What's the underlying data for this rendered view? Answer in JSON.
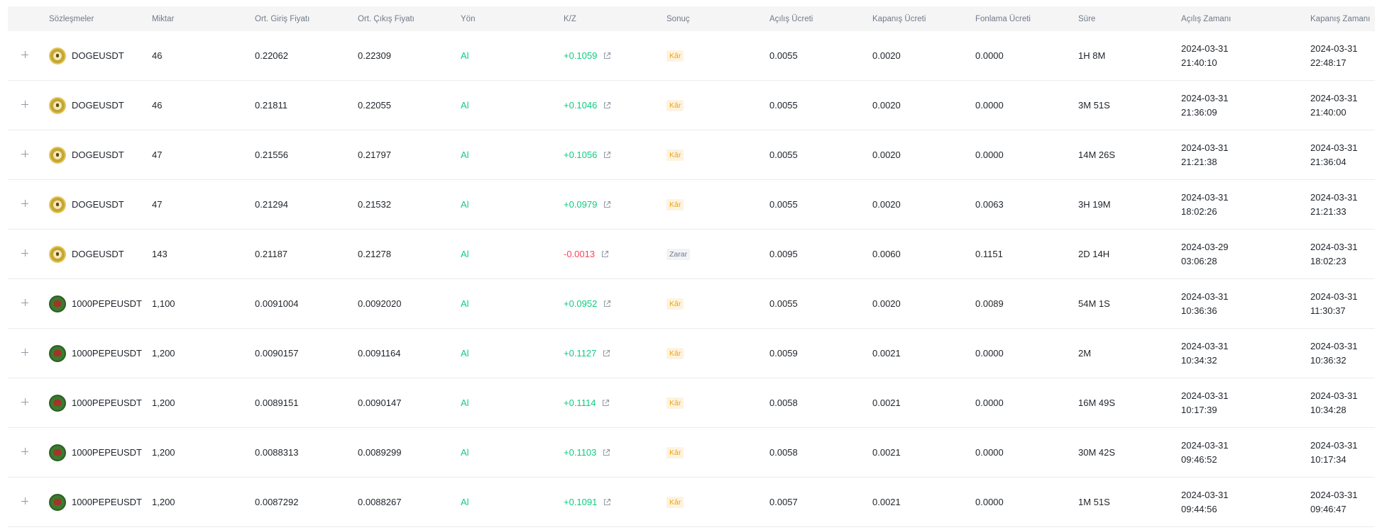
{
  "columns": {
    "symbol": "Sözleşmeler",
    "quantity": "Miktar",
    "entry": "Ort. Giriş Fiyatı",
    "exit": "Ort. Çıkış Fiyatı",
    "side": "Yön",
    "pnl": "K/Z",
    "result": "Sonuç",
    "open_fee": "Açılış Ücreti",
    "close_fee": "Kapanış Ücreti",
    "funding_fee": "Fonlama Ücreti",
    "duration": "Süre",
    "open_time": "Açılış Zamanı",
    "close_time": "Kapanış Zamanı"
  },
  "colors": {
    "profit": "#0ecb81",
    "loss": "#f6465d",
    "win_badge": "#f0a50a"
  },
  "icons": {
    "expand": "plus-icon",
    "share": "external-link-icon",
    "doge": "doge-coin-icon",
    "pepe": "pepe-coin-icon"
  },
  "rows": [
    {
      "symbol": "DOGEUSDT",
      "coin": "doge",
      "quantity": "46",
      "entry": "0.22062",
      "exit": "0.22309",
      "side": "Al",
      "pnl": "+0.1059",
      "pnl_sign": "pos",
      "result": "Kâr",
      "result_type": "win",
      "open_fee": "0.0055",
      "close_fee": "0.0020",
      "funding_fee": "0.0000",
      "duration": "1H 8M",
      "open_date": "2024-03-31",
      "open_clock": "21:40:10",
      "close_date": "2024-03-31",
      "close_clock": "22:48:17"
    },
    {
      "symbol": "DOGEUSDT",
      "coin": "doge",
      "quantity": "46",
      "entry": "0.21811",
      "exit": "0.22055",
      "side": "Al",
      "pnl": "+0.1046",
      "pnl_sign": "pos",
      "result": "Kâr",
      "result_type": "win",
      "open_fee": "0.0055",
      "close_fee": "0.0020",
      "funding_fee": "0.0000",
      "duration": "3M 51S",
      "open_date": "2024-03-31",
      "open_clock": "21:36:09",
      "close_date": "2024-03-31",
      "close_clock": "21:40:00"
    },
    {
      "symbol": "DOGEUSDT",
      "coin": "doge",
      "quantity": "47",
      "entry": "0.21556",
      "exit": "0.21797",
      "side": "Al",
      "pnl": "+0.1056",
      "pnl_sign": "pos",
      "result": "Kâr",
      "result_type": "win",
      "open_fee": "0.0055",
      "close_fee": "0.0020",
      "funding_fee": "0.0000",
      "duration": "14M 26S",
      "open_date": "2024-03-31",
      "open_clock": "21:21:38",
      "close_date": "2024-03-31",
      "close_clock": "21:36:04"
    },
    {
      "symbol": "DOGEUSDT",
      "coin": "doge",
      "quantity": "47",
      "entry": "0.21294",
      "exit": "0.21532",
      "side": "Al",
      "pnl": "+0.0979",
      "pnl_sign": "pos",
      "result": "Kâr",
      "result_type": "win",
      "open_fee": "0.0055",
      "close_fee": "0.0020",
      "funding_fee": "0.0063",
      "duration": "3H 19M",
      "open_date": "2024-03-31",
      "open_clock": "18:02:26",
      "close_date": "2024-03-31",
      "close_clock": "21:21:33"
    },
    {
      "symbol": "DOGEUSDT",
      "coin": "doge",
      "quantity": "143",
      "entry": "0.21187",
      "exit": "0.21278",
      "side": "Al",
      "pnl": "-0.0013",
      "pnl_sign": "neg",
      "result": "Zarar",
      "result_type": "loss",
      "open_fee": "0.0095",
      "close_fee": "0.0060",
      "funding_fee": "0.1151",
      "duration": "2D 14H",
      "open_date": "2024-03-29",
      "open_clock": "03:06:28",
      "close_date": "2024-03-31",
      "close_clock": "18:02:23"
    },
    {
      "symbol": "1000PEPEUSDT",
      "coin": "pepe",
      "quantity": "1,100",
      "entry": "0.0091004",
      "exit": "0.0092020",
      "side": "Al",
      "pnl": "+0.0952",
      "pnl_sign": "pos",
      "result": "Kâr",
      "result_type": "win",
      "open_fee": "0.0055",
      "close_fee": "0.0020",
      "funding_fee": "0.0089",
      "duration": "54M 1S",
      "open_date": "2024-03-31",
      "open_clock": "10:36:36",
      "close_date": "2024-03-31",
      "close_clock": "11:30:37"
    },
    {
      "symbol": "1000PEPEUSDT",
      "coin": "pepe",
      "quantity": "1,200",
      "entry": "0.0090157",
      "exit": "0.0091164",
      "side": "Al",
      "pnl": "+0.1127",
      "pnl_sign": "pos",
      "result": "Kâr",
      "result_type": "win",
      "open_fee": "0.0059",
      "close_fee": "0.0021",
      "funding_fee": "0.0000",
      "duration": "2M",
      "open_date": "2024-03-31",
      "open_clock": "10:34:32",
      "close_date": "2024-03-31",
      "close_clock": "10:36:32"
    },
    {
      "symbol": "1000PEPEUSDT",
      "coin": "pepe",
      "quantity": "1,200",
      "entry": "0.0089151",
      "exit": "0.0090147",
      "side": "Al",
      "pnl": "+0.1114",
      "pnl_sign": "pos",
      "result": "Kâr",
      "result_type": "win",
      "open_fee": "0.0058",
      "close_fee": "0.0021",
      "funding_fee": "0.0000",
      "duration": "16M 49S",
      "open_date": "2024-03-31",
      "open_clock": "10:17:39",
      "close_date": "2024-03-31",
      "close_clock": "10:34:28"
    },
    {
      "symbol": "1000PEPEUSDT",
      "coin": "pepe",
      "quantity": "1,200",
      "entry": "0.0088313",
      "exit": "0.0089299",
      "side": "Al",
      "pnl": "+0.1103",
      "pnl_sign": "pos",
      "result": "Kâr",
      "result_type": "win",
      "open_fee": "0.0058",
      "close_fee": "0.0021",
      "funding_fee": "0.0000",
      "duration": "30M 42S",
      "open_date": "2024-03-31",
      "open_clock": "09:46:52",
      "close_date": "2024-03-31",
      "close_clock": "10:17:34"
    },
    {
      "symbol": "1000PEPEUSDT",
      "coin": "pepe",
      "quantity": "1,200",
      "entry": "0.0087292",
      "exit": "0.0088267",
      "side": "Al",
      "pnl": "+0.1091",
      "pnl_sign": "pos",
      "result": "Kâr",
      "result_type": "win",
      "open_fee": "0.0057",
      "close_fee": "0.0021",
      "funding_fee": "0.0000",
      "duration": "1M 51S",
      "open_date": "2024-03-31",
      "open_clock": "09:44:56",
      "close_date": "2024-03-31",
      "close_clock": "09:46:47"
    }
  ]
}
